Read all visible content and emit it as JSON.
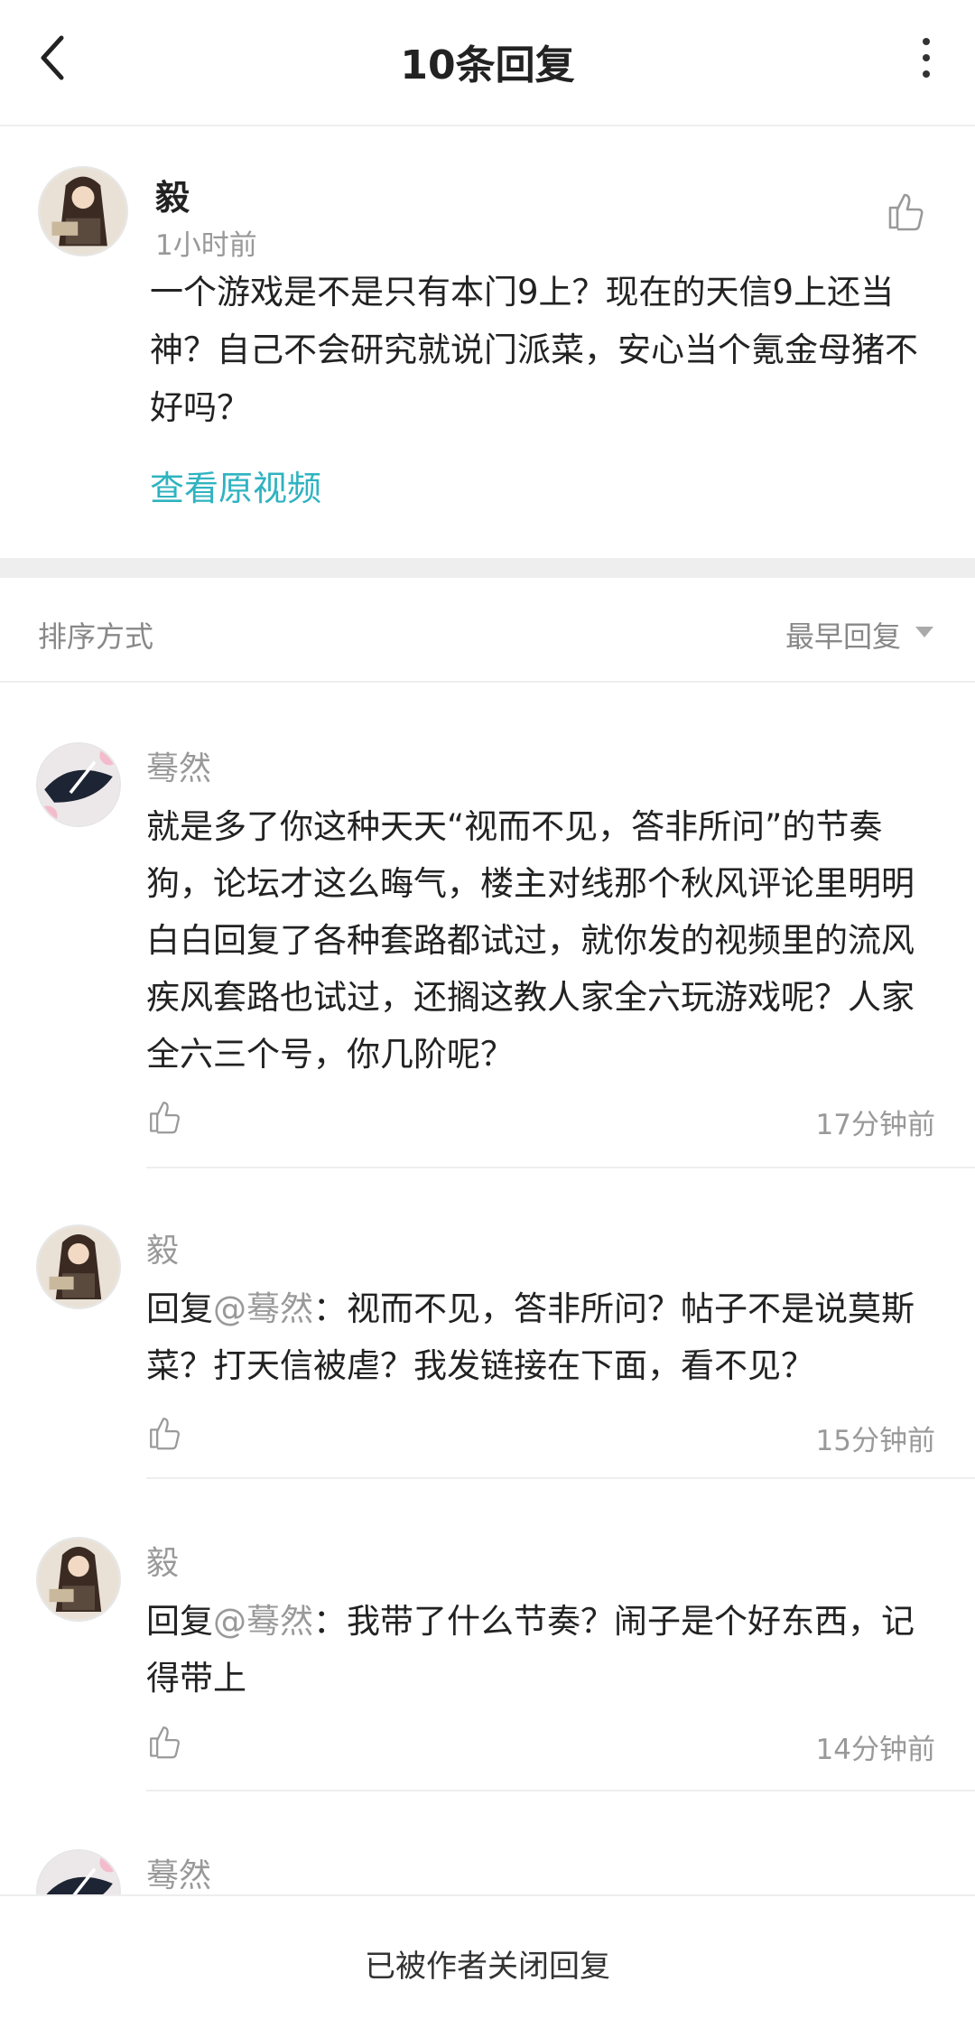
{
  "header": {
    "title": "10条回复"
  },
  "post": {
    "username": "毅",
    "time": "1小时前",
    "content": "一个游戏是不是只有本门9上？现在的天信9上还当神？自己不会研究就说门派菜，安心当个氪金母猪不好吗？",
    "link": "查看原视频"
  },
  "sort": {
    "label": "排序方式",
    "value": "最早回复"
  },
  "replies": [
    {
      "name": "蓦然",
      "text": "就是多了你这种天天“视而不见，答非所问”的节奏狗，论坛才这么晦气，楼主对线那个秋风评论里明明白白回复了各种套路都试过，就你发的视频里的流风疾风套路也试过，还搁这教人家全六玩游戏呢？人家全六三个号，你几阶呢？",
      "time": "17分钟前"
    },
    {
      "name": "毅",
      "prefix": "回复",
      "at": "@蓦然",
      "text": "：视而不见，答非所问？帖子不是说莫斯菜？打天信被虐？我发链接在下面，看不见？",
      "time": "15分钟前"
    },
    {
      "name": "毅",
      "prefix": "回复",
      "at": "@蓦然",
      "text": "：我带了什么节奏？闹子是个好东西，记得带上",
      "time": "14分钟前"
    },
    {
      "name": "蓦然"
    }
  ],
  "footer": {
    "text": "已被作者关闭回复"
  },
  "colors": {
    "link": "#2fb3c0",
    "muted": "#999999",
    "divider": "#eeeeee"
  }
}
